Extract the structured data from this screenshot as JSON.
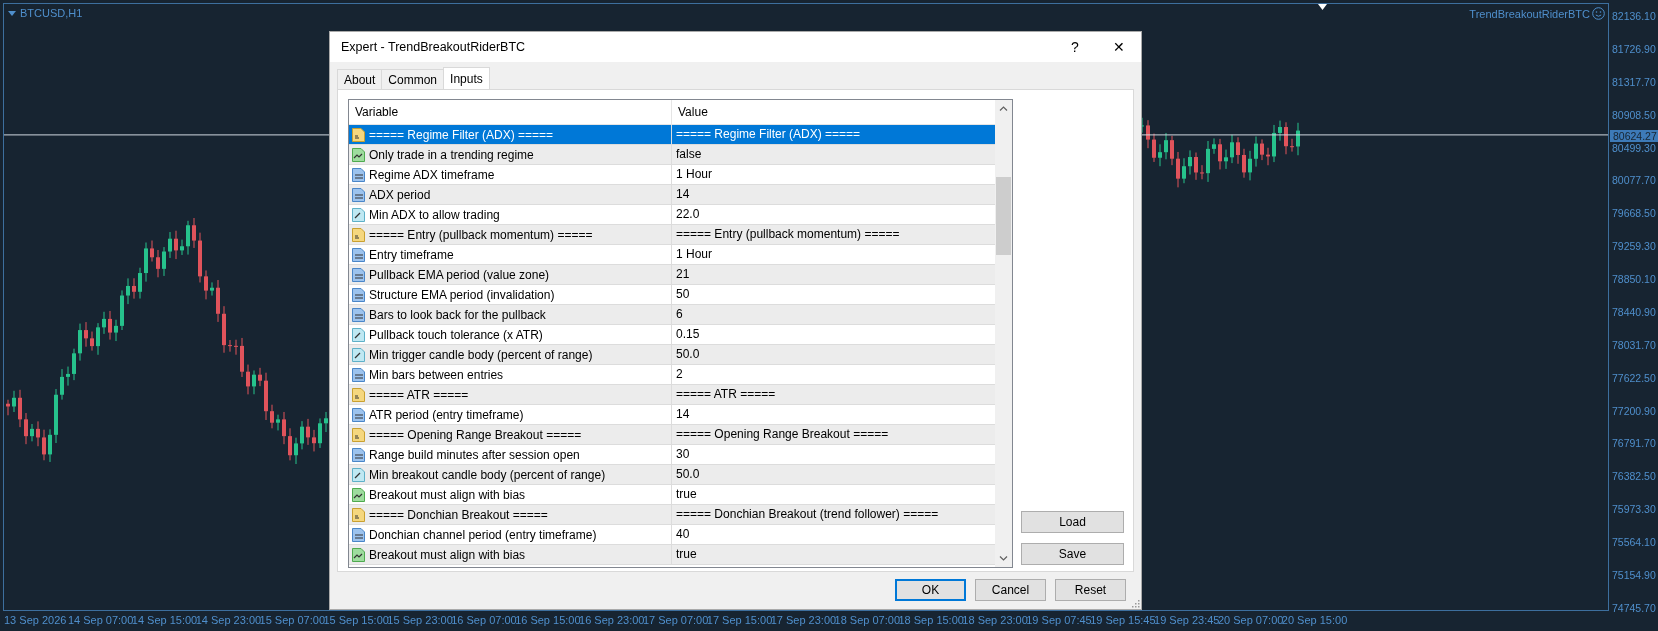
{
  "chart": {
    "symbol": "BTCUSD,H1",
    "expert_name": "TrendBreakoutRiderBTC",
    "current_price": "80624.27",
    "price_axis": [
      "82136.10",
      "81726.90",
      "81317.70",
      "80908.50",
      "80499.30",
      "80077.70",
      "79668.50",
      "79259.30",
      "78850.10",
      "78440.90",
      "78031.70",
      "77622.50",
      "77200.90",
      "76791.70",
      "76382.50",
      "75973.30",
      "75564.10",
      "75154.90",
      "74745.70"
    ],
    "time_axis": [
      "13 Sep 2026",
      "14 Sep 07:00",
      "14 Sep 15:00",
      "14 Sep 23:00",
      "15 Sep 07:00",
      "15 Sep 15:00",
      "15 Sep 23:00",
      "16 Sep 07:00",
      "16 Sep 15:00",
      "16 Sep 23:00",
      "17 Sep 07:00",
      "17 Sep 15:00",
      "17 Sep 23:00",
      "18 Sep 07:00",
      "18 Sep 15:00",
      "18 Sep 23:00",
      "19 Sep 07:45",
      "19 Sep 15:45",
      "19 Sep 23:45",
      "20 Sep 07:00",
      "20 Sep 15:00"
    ]
  },
  "dialog": {
    "title": "Expert - TrendBreakoutRiderBTC",
    "help": "?",
    "close": "✕",
    "tabs": [
      {
        "label": "About",
        "selected": false
      },
      {
        "label": "Common",
        "selected": false
      },
      {
        "label": "Inputs",
        "selected": true
      }
    ],
    "columns": [
      "Variable",
      "Value"
    ],
    "rows": [
      {
        "kind": "string",
        "variable": "===== Regime Filter (ADX) =====",
        "value": "===== Regime Filter (ADX) =====",
        "selected": true
      },
      {
        "kind": "bool",
        "variable": "Only trade in a trending regime",
        "value": "false",
        "selected": false
      },
      {
        "kind": "int",
        "variable": "Regime ADX timeframe",
        "value": "1 Hour",
        "selected": false
      },
      {
        "kind": "int",
        "variable": "ADX period",
        "value": "14",
        "selected": false
      },
      {
        "kind": "double",
        "variable": "Min ADX to allow trading",
        "value": "22.0",
        "selected": false
      },
      {
        "kind": "string",
        "variable": "===== Entry (pullback momentum) =====",
        "value": "===== Entry (pullback momentum) =====",
        "selected": false
      },
      {
        "kind": "int",
        "variable": "Entry timeframe",
        "value": "1 Hour",
        "selected": false
      },
      {
        "kind": "int",
        "variable": "Pullback EMA period (value zone)",
        "value": "21",
        "selected": false
      },
      {
        "kind": "int",
        "variable": "Structure EMA period (invalidation)",
        "value": "50",
        "selected": false
      },
      {
        "kind": "int",
        "variable": "Bars to look back for the pullback",
        "value": "6",
        "selected": false
      },
      {
        "kind": "double",
        "variable": "Pullback touch tolerance (x ATR)",
        "value": "0.15",
        "selected": false
      },
      {
        "kind": "double",
        "variable": "Min trigger candle body (percent of range)",
        "value": "50.0",
        "selected": false
      },
      {
        "kind": "int",
        "variable": "Min bars between entries",
        "value": "2",
        "selected": false
      },
      {
        "kind": "string",
        "variable": "===== ATR =====",
        "value": "===== ATR =====",
        "selected": false
      },
      {
        "kind": "int",
        "variable": "ATR period (entry timeframe)",
        "value": "14",
        "selected": false
      },
      {
        "kind": "string",
        "variable": "===== Opening Range Breakout =====",
        "value": "===== Opening Range Breakout =====",
        "selected": false
      },
      {
        "kind": "int",
        "variable": "Range build minutes after session open",
        "value": "30",
        "selected": false
      },
      {
        "kind": "double",
        "variable": "Min breakout candle body (percent of range)",
        "value": "50.0",
        "selected": false
      },
      {
        "kind": "bool",
        "variable": "Breakout must align with bias",
        "value": "true",
        "selected": false
      },
      {
        "kind": "string",
        "variable": "===== Donchian Breakout =====",
        "value": "===== Donchian Breakout (trend follower) =====",
        "selected": false
      },
      {
        "kind": "int",
        "variable": "Donchian channel period (entry timeframe)",
        "value": "40",
        "selected": false
      },
      {
        "kind": "bool",
        "variable": "Breakout must align with bias",
        "value": "true",
        "selected": false
      }
    ],
    "side_buttons": [
      "Load",
      "Save"
    ],
    "buttons": [
      {
        "label": "OK",
        "default": true
      },
      {
        "label": "Cancel",
        "default": false
      },
      {
        "label": "Reset",
        "default": false
      }
    ]
  }
}
